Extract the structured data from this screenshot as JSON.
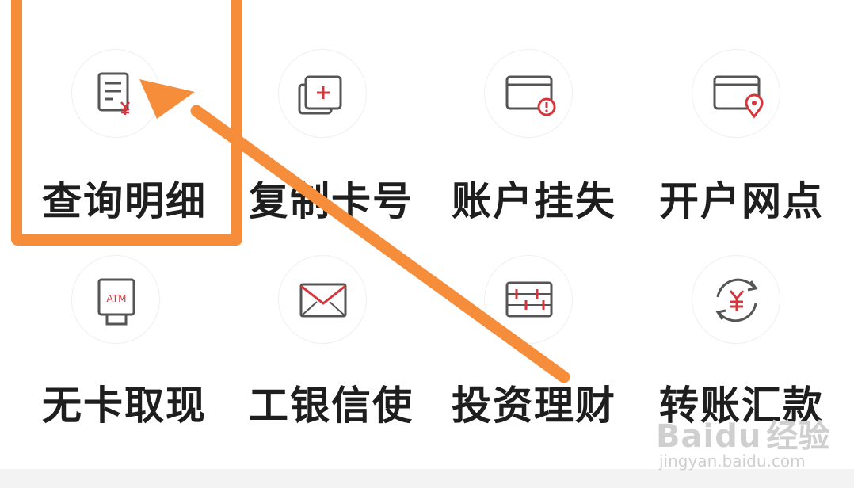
{
  "grid": {
    "items": [
      {
        "label": "查询明细",
        "icon": "statement-yuan-icon"
      },
      {
        "label": "复制卡号",
        "icon": "copy-card-icon"
      },
      {
        "label": "账户挂失",
        "icon": "card-alert-icon"
      },
      {
        "label": "开户网点",
        "icon": "card-location-icon"
      },
      {
        "label": "无卡取现",
        "icon": "atm-icon"
      },
      {
        "label": "工银信使",
        "icon": "envelope-icon"
      },
      {
        "label": "投资理财",
        "icon": "abacus-icon"
      },
      {
        "label": "转账汇款",
        "icon": "transfer-yuan-icon"
      }
    ]
  },
  "annotation": {
    "highlight_color": "#f68d3b",
    "highlighted_item": "查询明细",
    "arrow_icon": "pointer-arrow-icon"
  },
  "watermark": {
    "brand": "Baidu",
    "sub": "经验",
    "url": "jingyan.baidu.com"
  },
  "colors": {
    "icon_stroke": "#555555",
    "icon_accent": "#d6353b",
    "label": "#1e1e1e"
  }
}
